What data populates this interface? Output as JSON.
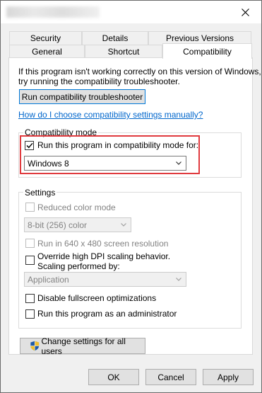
{
  "tabs_row1": [
    "Security",
    "Details",
    "Previous Versions"
  ],
  "tabs_row2": [
    "General",
    "Shortcut",
    "Compatibility"
  ],
  "active_tab": "Compatibility",
  "intro_text_line1": "If this program isn't working correctly on this version of Windows,",
  "intro_text_line2": "try running the compatibility troubleshooter.",
  "troubleshooter_button": "Run compatibility troubleshooter",
  "help_link": "How do I choose compatibility settings manually?",
  "compat_mode": {
    "legend": "Compatibility mode",
    "checkbox_label": "Run this program in compatibility mode for:",
    "checked": true,
    "selected_os": "Windows 8"
  },
  "settings": {
    "legend": "Settings",
    "reduced_color_label": "Reduced color mode",
    "color_select_value": "8-bit (256) color",
    "resolution_label": "Run in 640 x 480 screen resolution",
    "dpi_label_line1": "Override high DPI scaling behavior.",
    "dpi_label_line2": "Scaling performed by:",
    "dpi_select_value": "Application",
    "fullscreen_label": "Disable fullscreen optimizations",
    "admin_label": "Run this program as an administrator"
  },
  "change_all_button": "Change settings for all users",
  "footer": {
    "ok": "OK",
    "cancel": "Cancel",
    "apply": "Apply"
  },
  "colors": {
    "highlight_border": "#e03a3e",
    "link": "#0066cc",
    "focus": "#0078d7"
  }
}
